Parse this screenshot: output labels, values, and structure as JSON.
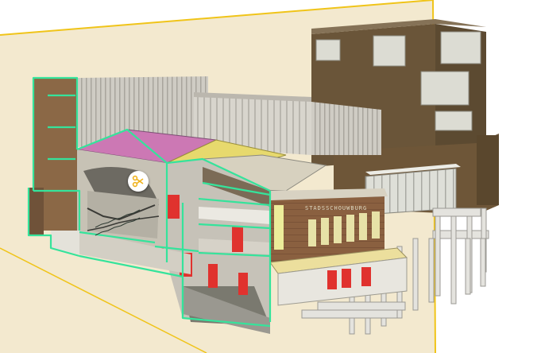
{
  "viewer": {
    "facade_lettering": "STADSSCHOUWBURG",
    "tool": {
      "icon": "scissors-icon",
      "name": "section-cut-tool"
    },
    "colors": {
      "section_plane": "#f3e9cf",
      "plane_edge": "#f0c419",
      "cut_outline": "#35e39b",
      "roof_magenta": "#cc78b4",
      "roof_yellow": "#e7d96d",
      "brick": "#7d5a3f",
      "dark_tower": "#6a5539",
      "glass": "#dcdcd3",
      "fire_door": "#e0322e",
      "tool_accent": "#f0b31e"
    }
  }
}
